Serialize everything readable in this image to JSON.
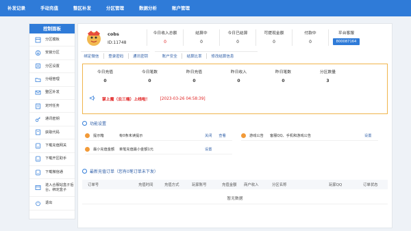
{
  "topnav": [
    "补发记录",
    "手动充值",
    "整区补发",
    "分区管理",
    "数据分析",
    "账户管理"
  ],
  "sidebar": {
    "title": "控制面板",
    "items": [
      {
        "label": "分区模板",
        "icon": "template-icon"
      },
      {
        "label": "安装分区",
        "icon": "install-icon"
      },
      {
        "label": "分区设置",
        "icon": "settings-icon"
      },
      {
        "label": "分组管理",
        "icon": "folder-icon"
      },
      {
        "label": "整区补发",
        "icon": "mail-icon"
      },
      {
        "label": "定时任务",
        "icon": "clock-icon"
      },
      {
        "label": "通讯密钥",
        "icon": "key-icon"
      },
      {
        "label": "获取代码",
        "icon": "code-icon"
      },
      {
        "label": "下载充值网关",
        "icon": "download-icon"
      },
      {
        "label": "下载开区助手",
        "icon": "download-icon"
      },
      {
        "label": "下载微信通",
        "icon": "download-icon"
      },
      {
        "label": "进入合服站盒子后台，绑定盒子",
        "icon": "box-icon"
      },
      {
        "label": "退出",
        "icon": "power-icon"
      }
    ]
  },
  "profile": {
    "name": "cobs",
    "id": "ID:11748",
    "stats": [
      {
        "label": "今日收入总额",
        "value": "0",
        "red": true
      },
      {
        "label": "结算中",
        "value": "0",
        "red": false
      },
      {
        "label": "今日已结算",
        "value": "0",
        "red": false
      },
      {
        "label": "可提现金额",
        "value": "0",
        "red": false
      },
      {
        "label": "付款中",
        "value": "0",
        "red": false
      }
    ],
    "service": {
      "label": "平台客服",
      "button": "800087164"
    },
    "links": [
      "绑定微信",
      "登录密码",
      "通讯密钥",
      "账户安全",
      "结算比率",
      "修改结算信息"
    ]
  },
  "overview": {
    "stats": [
      {
        "label": "今日充值",
        "value": "0"
      },
      {
        "label": "今日笔数",
        "value": "0"
      },
      {
        "label": "昨日充值",
        "value": "0"
      },
      {
        "label": "昨日收入",
        "value": "0"
      },
      {
        "label": "昨日笔数",
        "value": "0"
      },
      {
        "label": "分区数量",
        "value": "3"
      }
    ],
    "notice": {
      "message": "掌上魔（云三端）上线啦！",
      "time": "[2023-03-26 04:58:39]"
    }
  },
  "functions": {
    "title": "功能设置",
    "items": [
      {
        "name": "提示箱",
        "desc": "有0条未读提示",
        "actions": [
          "关闭",
          "查看"
        ]
      },
      {
        "name": "游戏公告",
        "desc": "客服QQ、手机和游戏公告",
        "actions": [
          "设置"
        ]
      },
      {
        "name": "最小充值金额",
        "desc": "单笔充值最小金额1元",
        "actions": [
          "设置"
        ]
      }
    ]
  },
  "orders": {
    "title": "最新充值订单（您有0笔订单未下发）",
    "columns": [
      "订单号",
      "充值时间",
      "充值方式",
      "玩家账号",
      "充值金额",
      "商户收入",
      "分区名称",
      "玩家QQ",
      "订单状态"
    ],
    "empty": "暂无数据"
  },
  "colors": {
    "primary": "#2f7bd8",
    "alert": "#e02020",
    "border_warning": "#f0b449",
    "accent_orange": "#f29a38"
  }
}
